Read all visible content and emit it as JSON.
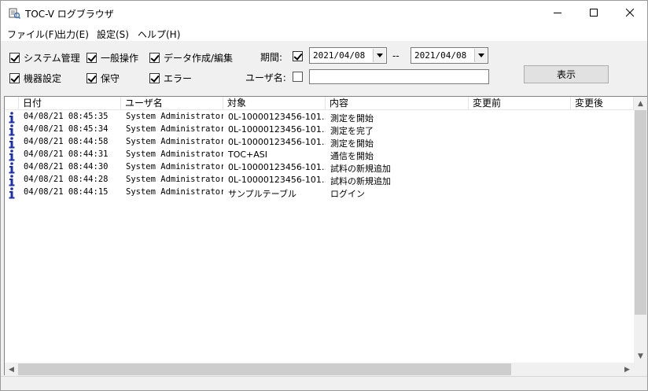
{
  "window": {
    "title": "TOC-V ログブラウザ"
  },
  "menu": [
    {
      "label": "ファイル(F)"
    },
    {
      "label": "出力(E)"
    },
    {
      "label": "設定(S)"
    },
    {
      "label": "ヘルプ(H)"
    }
  ],
  "filters": {
    "categories": [
      {
        "label": "システム管理",
        "checked": true
      },
      {
        "label": "一般操作",
        "checked": true
      },
      {
        "label": "データ作成/編集",
        "checked": true
      },
      {
        "label": "機器設定",
        "checked": true
      },
      {
        "label": "保守",
        "checked": true
      },
      {
        "label": "エラー",
        "checked": true
      }
    ],
    "period_label": "期間:",
    "period_checked": true,
    "date_from": "2021/04/08",
    "date_separator": "--",
    "date_to": "2021/04/08",
    "user_label": "ユーザ名:",
    "user_checked": false,
    "user_value": "",
    "show_button": "表示"
  },
  "table": {
    "columns": [
      "日付",
      "ユーザ名",
      "対象",
      "内容",
      "変更前",
      "変更後"
    ],
    "rows": [
      {
        "date": "04/08/21 08:45:35",
        "user": "System Administrator",
        "target": "0L-10000123456-101…",
        "content": "測定を開始",
        "before": "",
        "after": ""
      },
      {
        "date": "04/08/21 08:45:34",
        "user": "System Administrator",
        "target": "0L-10000123456-101…",
        "content": "測定を完了",
        "before": "",
        "after": ""
      },
      {
        "date": "04/08/21 08:44:58",
        "user": "System Administrator",
        "target": "0L-10000123456-101…",
        "content": "測定を開始",
        "before": "",
        "after": ""
      },
      {
        "date": "04/08/21 08:44:31",
        "user": "System Administrator",
        "target": "TOC+ASI",
        "content": "通信を開始",
        "before": "",
        "after": ""
      },
      {
        "date": "04/08/21 08:44:30",
        "user": "System Administrator",
        "target": "0L-10000123456-101…",
        "content": "試料の新規追加",
        "before": "",
        "after": ""
      },
      {
        "date": "04/08/21 08:44:28",
        "user": "System Administrator",
        "target": "0L-10000123456-101…",
        "content": "試料の新規追加",
        "before": "",
        "after": ""
      },
      {
        "date": "04/08/21 08:44:15",
        "user": "System Administrator",
        "target": "サンプルテーブル",
        "content": "ログイン",
        "before": "",
        "after": ""
      }
    ]
  },
  "colors": {
    "info_icon": "#1c2fb0"
  }
}
